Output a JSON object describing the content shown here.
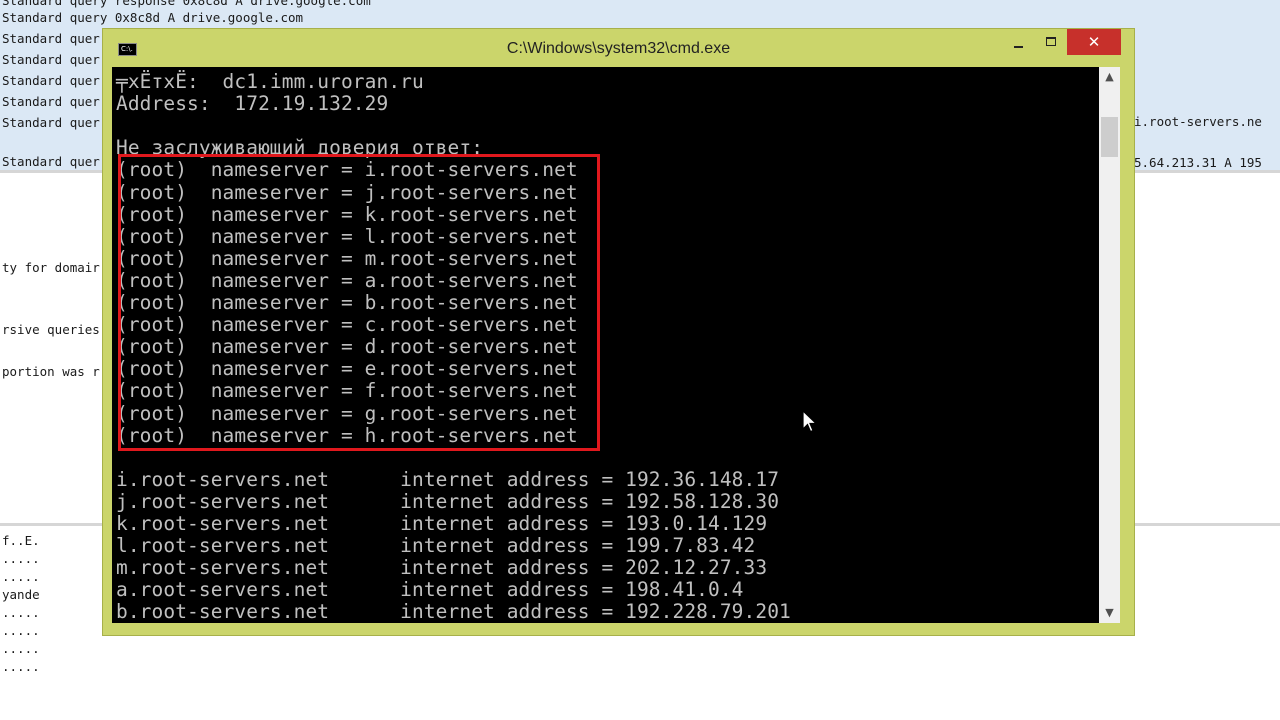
{
  "background": {
    "packet_rows": [
      "Standard query response 0x8c8d A drive.google.com",
      "Standard query 0x8c8d A drive.google.com",
      "Standard quer",
      "Standard quer",
      "Standard quer",
      "Standard quer",
      "Standard quer",
      "Standard quer"
    ],
    "packet_rows_right": [
      "i.root-servers.ne",
      "5.64.213.31 A 195"
    ],
    "detail_lines": [
      "ty for domair",
      "rsive queries",
      "portion was r"
    ],
    "hex_lines": [
      "f..E.",
      ".....",
      ".....",
      "yande",
      ".....",
      ".....",
      ".....",
      "....."
    ]
  },
  "window": {
    "title": "C:\\Windows\\system32\\cmd.exe",
    "icon_label": "C:\\.",
    "close_glyph": "✕",
    "scroll_up_glyph": "▲",
    "scroll_down_glyph": "▼"
  },
  "console": {
    "lines": [
      "╤xЁтxЁ:  dc1.imm.uroran.ru",
      "Address:  172.19.132.29",
      "",
      "Не заслуживающий доверия ответ:",
      "(root)  nameserver = i.root-servers.net",
      "(root)  nameserver = j.root-servers.net",
      "(root)  nameserver = k.root-servers.net",
      "(root)  nameserver = l.root-servers.net",
      "(root)  nameserver = m.root-servers.net",
      "(root)  nameserver = a.root-servers.net",
      "(root)  nameserver = b.root-servers.net",
      "(root)  nameserver = c.root-servers.net",
      "(root)  nameserver = d.root-servers.net",
      "(root)  nameserver = e.root-servers.net",
      "(root)  nameserver = f.root-servers.net",
      "(root)  nameserver = g.root-servers.net",
      "(root)  nameserver = h.root-servers.net",
      "",
      "i.root-servers.net      internet address = 192.36.148.17",
      "j.root-servers.net      internet address = 192.58.128.30",
      "k.root-servers.net      internet address = 193.0.14.129",
      "l.root-servers.net      internet address = 199.7.83.42",
      "m.root-servers.net      internet address = 202.12.27.33",
      "a.root-servers.net      internet address = 198.41.0.4",
      "b.root-servers.net      internet address = 192.228.79.201"
    ]
  },
  "colors": {
    "console_bg": "#000000",
    "console_fg": "#c0c0c0",
    "frame": "#cbd56b",
    "highlight": "#e0181d",
    "close_button": "#c7302b"
  }
}
